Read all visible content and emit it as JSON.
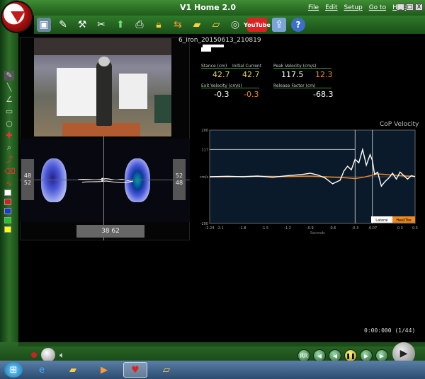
{
  "window": {
    "title": "V1 Home 2.0",
    "menu": [
      "File",
      "Edit",
      "Setup",
      "Go to",
      "Help"
    ],
    "controls": [
      "_",
      "□",
      "X"
    ]
  },
  "toolbar": {
    "icons": [
      "capture-icon",
      "edit-icon",
      "club-icon",
      "scissors-icon",
      "import-icon",
      "print-icon",
      "lock-icon",
      "swap-icon",
      "folder-icon",
      "folder-open-icon",
      "film-reel-icon",
      "youtube-icon",
      "export-icon",
      "help-icon"
    ],
    "youtube_label": "YouTube",
    "help_label": "?"
  },
  "tools": {
    "icons": [
      "pencil-icon",
      "line-icon",
      "angle-icon",
      "rectangle-icon",
      "circle-icon",
      "crosshair-icon",
      "zoom-icon",
      "trace-icon",
      "eraser-icon",
      "curve-icon",
      "clear-icon"
    ],
    "colors": [
      "#ffffff",
      "#d42020",
      "#1a3ad8",
      "#1ec81e",
      "#ffff00"
    ]
  },
  "pressure": {
    "left_box": [
      "48",
      "52"
    ],
    "right_box": [
      "52",
      "48"
    ],
    "bottom_box": "38 62"
  },
  "data_panel": {
    "file_name": "6_iron_20150613_210819",
    "stance_label": "Stance (cm)",
    "initial_current_label": "Initial  Current",
    "stance_initial": "42.7",
    "stance_current": "42.7",
    "peak_label": "Peak Velocity (cm/s)",
    "peak_value": "117.5",
    "peak_value2": "12.3",
    "exit_label": "Exit Velocity (cm/s)",
    "exit_value": "-0.3",
    "exit_value2": "-0.3",
    "release_label": "Release Factor (cm)",
    "release_value": "-68.3",
    "colors": {
      "white": "#ffffff",
      "yellow": "#e8d24a",
      "orange": "#f08a1c",
      "green_line": "#3b8f3b"
    }
  },
  "chart_data": {
    "type": "line",
    "title": "CoP Velocity",
    "xlabel": "Seconds",
    "ylabel": "cm/s",
    "ylim": [
      -200,
      200
    ],
    "xlim": [
      -2.24,
      0.5
    ],
    "y_ticks": [
      "200",
      "117",
      "cm/s",
      "-200"
    ],
    "x_ticks": [
      "-2.24",
      "-2.1",
      "-1.8",
      "-1.5",
      "-1.2",
      "-0.9",
      "-0.6",
      "-0.3",
      "-0.07",
      "0.3",
      "0.5"
    ],
    "markers": [
      -0.3,
      -0.07
    ],
    "peak_line": 117,
    "legend": [
      "Lateral",
      "Heel/Toe"
    ],
    "series": [
      {
        "name": "Lateral",
        "color": "#ffffff",
        "x": [
          -2.24,
          -2.0,
          -1.8,
          -1.6,
          -1.4,
          -1.2,
          -1.0,
          -0.9,
          -0.8,
          -0.7,
          -0.6,
          -0.5,
          -0.45,
          -0.4,
          -0.35,
          -0.3,
          -0.25,
          -0.2,
          -0.15,
          -0.1,
          -0.07,
          -0.04,
          0.0,
          0.05,
          0.1,
          0.15,
          0.2,
          0.25,
          0.3,
          0.35,
          0.4,
          0.45,
          0.5
        ],
        "y": [
          0,
          2,
          0,
          3,
          -2,
          5,
          10,
          15,
          8,
          -5,
          -30,
          -15,
          25,
          45,
          30,
          75,
          60,
          117,
          50,
          95,
          70,
          10,
          20,
          -40,
          -20,
          -5,
          15,
          -10,
          20,
          5,
          -10,
          5,
          0
        ]
      },
      {
        "name": "Heel/Toe",
        "color": "#f08a1c",
        "x": [
          -2.24,
          -2.0,
          -1.6,
          -1.2,
          -0.9,
          -0.7,
          -0.5,
          -0.4,
          -0.3,
          -0.2,
          -0.1,
          0.0,
          0.1,
          0.2,
          0.3,
          0.4,
          0.5
        ],
        "y": [
          0,
          0,
          2,
          1,
          3,
          0,
          -3,
          -5,
          -8,
          -3,
          5,
          12,
          10,
          8,
          5,
          3,
          2
        ]
      }
    ]
  },
  "playback": {
    "time": "0:00:000",
    "frame": "(1/44)",
    "buttons": [
      "fps-button",
      "rewind-button",
      "step-back-button",
      "pause-button",
      "step-forward-button",
      "fast-forward-button"
    ],
    "fps_label": "RR"
  },
  "taskbar": {
    "items": [
      "ie-icon",
      "file-explorer-icon",
      "media-player-icon",
      "v1-home-icon",
      "folder-icon"
    ]
  }
}
